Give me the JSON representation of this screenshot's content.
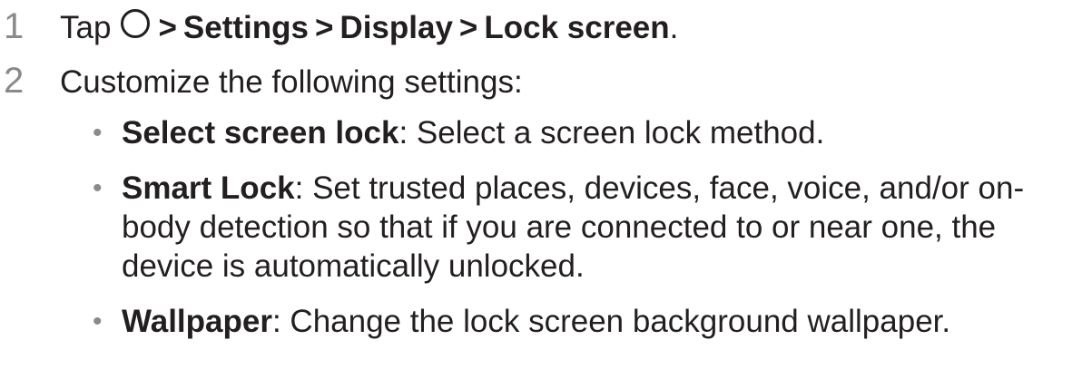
{
  "steps": [
    {
      "number": "1",
      "tap_label": "Tap",
      "path": [
        "Settings",
        "Display",
        "Lock screen"
      ],
      "separator": ">",
      "end_punct": "."
    },
    {
      "number": "2",
      "text": "Customize the following settings:"
    }
  ],
  "bullet_glyph": "•",
  "icons": {
    "home": "home-button-circle-icon"
  },
  "settings": [
    {
      "term": "Select screen lock",
      "description": ": Select a screen lock method."
    },
    {
      "term": "Smart Lock",
      "description": ": Set trusted places, devices, face, voice, and/or on-body detection so that if you are connected to or near one, the device is automatically unlocked."
    },
    {
      "term": "Wallpaper",
      "description": ": Change the lock screen background wallpaper."
    }
  ]
}
